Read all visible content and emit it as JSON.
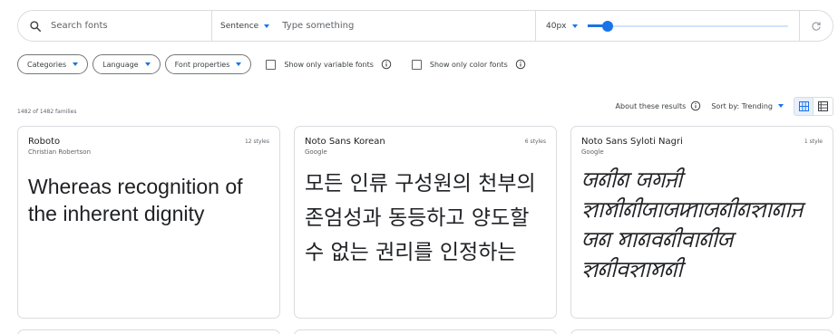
{
  "search": {
    "placeholder": "Search fonts"
  },
  "preview": {
    "mode": "Sentence",
    "placeholder": "Type something"
  },
  "size": {
    "label": "40px",
    "slider_level_fraction": 0.1
  },
  "filters": {
    "categories": "Categories",
    "language": "Language",
    "font_properties": "Font properties",
    "variable_label": "Show only variable fonts",
    "color_label": "Show only color fonts"
  },
  "results": {
    "count": "1482 of 1482 families",
    "about": "About these results",
    "sort": "Sort by: Trending"
  },
  "cards": [
    {
      "family": "Roboto",
      "designer": "Christian Robertson",
      "styles": "12 styles",
      "sample": "Whereas recognition of the inherent dignity"
    },
    {
      "family": "Noto Sans Korean",
      "designer": "Google",
      "styles": "6 styles",
      "sample": "모든 인류 구성원의 천부의 존엄성과 동등하고 양도할 수 없는 권리를 인정하는"
    },
    {
      "family": "Noto Sans Syloti Nagri",
      "designer": "Google",
      "styles": "1 style",
      "sample": "ꠎꠘꠤꠘ ꠎꠉꠔꠤ ꠡꠣꠝꠤꠘꠤꠎꠣꠎꠇꠣꠎꠘꠤꠘꠡꠣꠘꠣꠔ ꠎꠘ ꠝꠣꠘꠛꠘꠤꠛꠣꠘꠤꠎ ꠡꠘꠤꠛꠡꠣꠝꠘꠤ"
    }
  ],
  "colors": {
    "accent": "#1a73e8",
    "border": "#dadce0"
  }
}
